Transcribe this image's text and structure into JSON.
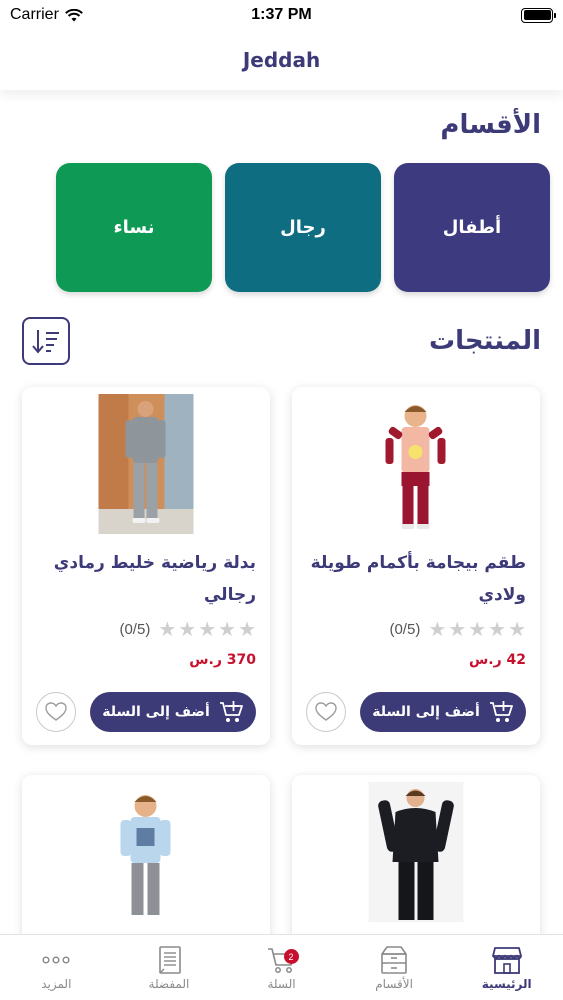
{
  "status_bar": {
    "carrier": "Carrier",
    "time": "1:37 PM"
  },
  "nav": {
    "title": "Jeddah"
  },
  "categories_section": {
    "title": "الأقسام",
    "items": [
      {
        "label": "أطفال",
        "color": "#3d3a80"
      },
      {
        "label": "رجال",
        "color": "#0e6d80"
      },
      {
        "label": "نساء",
        "color": "#0e9a55"
      }
    ]
  },
  "products_section": {
    "title": "المنتجات",
    "products": [
      {
        "name": "طقم بيجامة بأكمام طويلة ولادي",
        "rating_text": "(0/5)",
        "rating": 0,
        "price": "42 ر.س",
        "add_to_cart": "أضف إلى السلة"
      },
      {
        "name": "بدلة رياضية خليط رمادي رجالي",
        "rating_text": "(0/5)",
        "rating": 0,
        "price": "370 ر.س",
        "add_to_cart": "أضف إلى السلة"
      },
      {
        "name": "",
        "rating_text": "",
        "price": "",
        "add_to_cart": ""
      },
      {
        "name": "",
        "rating_text": "",
        "price": "",
        "add_to_cart": ""
      }
    ]
  },
  "tab_bar": {
    "tabs": [
      {
        "label": "الرئيسية",
        "icon": "store-icon",
        "active": true
      },
      {
        "label": "الأقسام",
        "icon": "box-icon",
        "active": false
      },
      {
        "label": "السلة",
        "icon": "cart-icon",
        "badge": "2",
        "active": false
      },
      {
        "label": "المفضلة",
        "icon": "list-icon",
        "active": false
      },
      {
        "label": "المزيد",
        "icon": "more-icon",
        "active": false
      }
    ]
  },
  "colors": {
    "primary": "#3d3a78",
    "price": "#c8102e"
  }
}
